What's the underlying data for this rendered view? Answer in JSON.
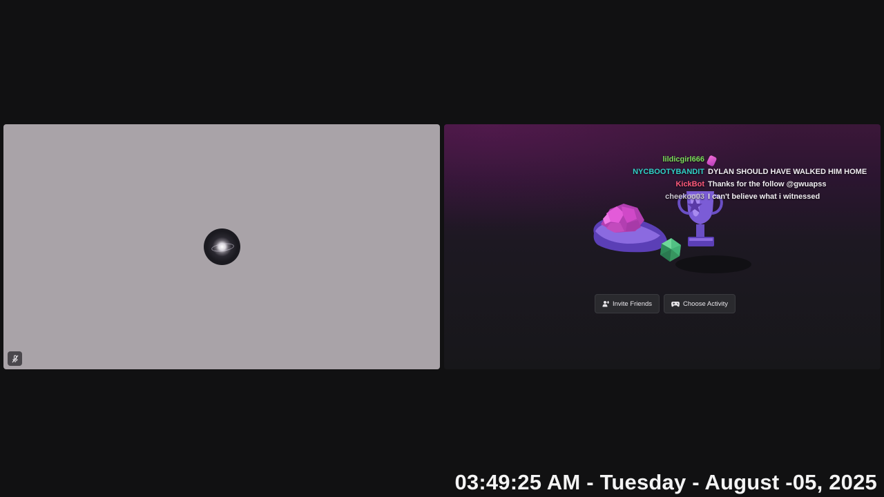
{
  "left_tile": {
    "avatar_icon": "planet-avatar-icon",
    "mute_icon": "mic-muted-icon"
  },
  "right_tile": {
    "illustration": "activity-trophy-illustration",
    "buttons": {
      "invite_label": "Invite Friends",
      "invite_icon": "add-person-icon",
      "activity_label": "Choose Activity",
      "activity_icon": "gamepad-icon"
    }
  },
  "chat": [
    {
      "user": "lildicgirl666",
      "message": "",
      "user_color": "#7be05a",
      "emote": "pink-emote-icon"
    },
    {
      "user": "NYCBOOTYBANDIT",
      "message": "DYLAN SHOULD HAVE WALKED HIM HOME",
      "user_color": "#2fd1c6"
    },
    {
      "user": "KickBot",
      "message": "Thanks for the follow @gwuapss",
      "user_color": "#ff5a7a"
    },
    {
      "user": "cheekoo03",
      "message": "I can't believe what i witnessed",
      "user_color": "#c9c4cf"
    }
  ],
  "clock": {
    "text": "03:49:25 AM - Tuesday - August -05, 2025"
  },
  "colors": {
    "background": "#111112",
    "left_tile_bg": "#a9a3a8",
    "button_bg": "#2a2a2e"
  }
}
